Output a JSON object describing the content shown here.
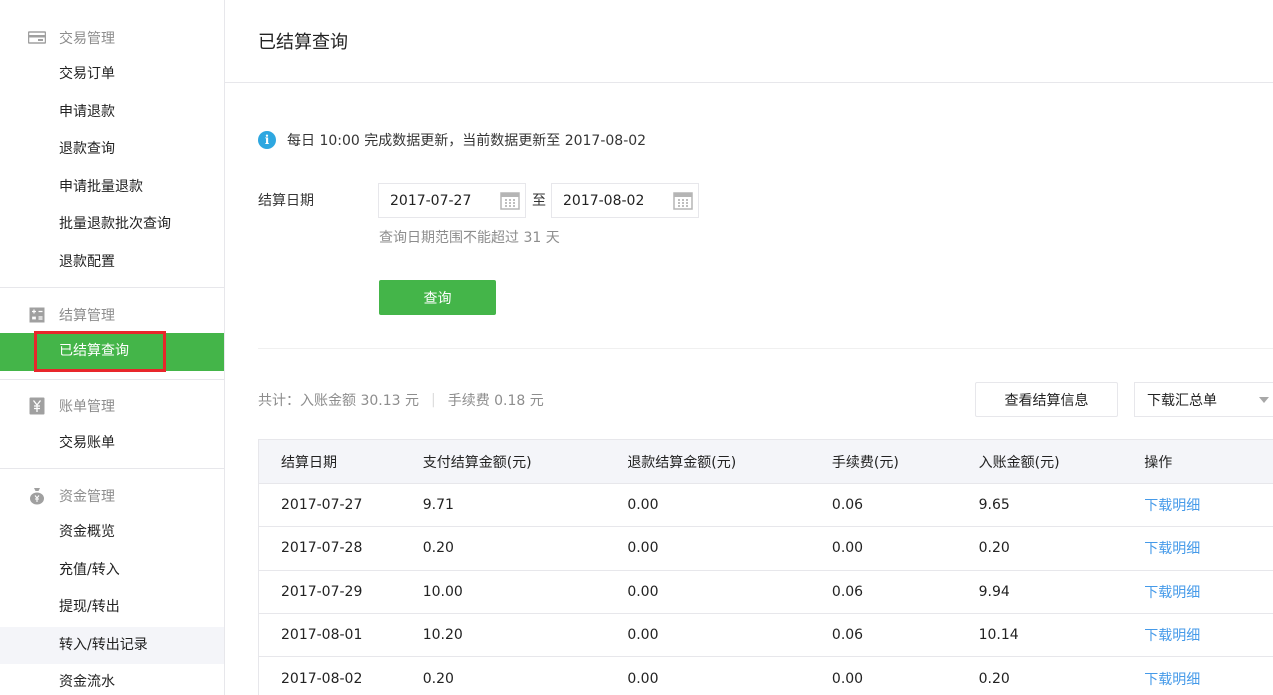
{
  "sidebar": {
    "groups": [
      {
        "title": "交易管理",
        "icon": "card-icon",
        "items": [
          "交易订单",
          "申请退款",
          "退款查询",
          "申请批量退款",
          "批量退款批次查询",
          "退款配置"
        ]
      },
      {
        "title": "结算管理",
        "icon": "calculator-icon",
        "items": [
          "已结算查询"
        ]
      },
      {
        "title": "账单管理",
        "icon": "yen-icon",
        "items": [
          "交易账单"
        ]
      },
      {
        "title": "资金管理",
        "icon": "money-bag-icon",
        "items": [
          "资金概览",
          "充值/转入",
          "提现/转出",
          "转入/转出记录",
          "资金流水"
        ]
      }
    ],
    "active_item": "已结算查询",
    "hover_item": "转入/转出记录"
  },
  "page": {
    "title": "已结算查询",
    "notice": "每日 10:00 完成数据更新，当前数据更新至 2017-08-02",
    "date_label": "结算日期",
    "start_date": "2017-07-27",
    "date_separator": "至",
    "end_date": "2017-08-02",
    "date_hint": "查询日期范围不能超过 31 天",
    "query_button": "查询",
    "summary_income": "共计：入账金额 30.13 元",
    "summary_divider": "|",
    "summary_fee": "手续费 0.18 元",
    "view_settlement_button": "查看结算信息",
    "download_select": "下载汇总单"
  },
  "table": {
    "headers": [
      "结算日期",
      "支付结算金额(元)",
      "退款结算金额(元)",
      "手续费(元)",
      "入账金额(元)",
      "操作"
    ],
    "rows": [
      [
        "2017-07-27",
        "9.71",
        "0.00",
        "0.06",
        "9.65",
        "下载明细"
      ],
      [
        "2017-07-28",
        "0.20",
        "0.00",
        "0.00",
        "0.20",
        "下载明细"
      ],
      [
        "2017-07-29",
        "10.00",
        "0.00",
        "0.06",
        "9.94",
        "下载明细"
      ],
      [
        "2017-08-01",
        "10.20",
        "0.00",
        "0.06",
        "10.14",
        "下载明细"
      ],
      [
        "2017-08-02",
        "0.20",
        "0.00",
        "0.00",
        "0.20",
        "下载明细"
      ]
    ]
  },
  "colors": {
    "accent_green": "#44b549",
    "link_blue": "#459ae9",
    "highlight_red": "#e8262b",
    "info_blue": "#2ea7e0"
  }
}
